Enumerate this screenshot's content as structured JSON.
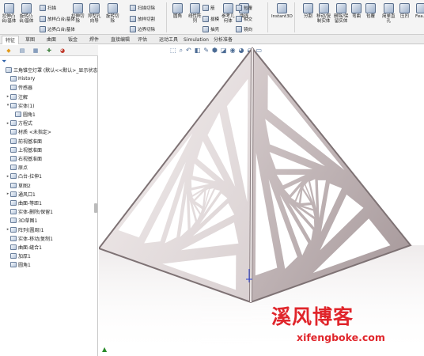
{
  "ribbon": {
    "buttons": [
      {
        "name": "extruded-boss-button",
        "icon": "extrude-icon",
        "label": "拉伸凸\n台/基体"
      },
      {
        "name": "revolved-boss-button",
        "icon": "revolve-icon",
        "label": "旋转凸\n台/基体"
      },
      {
        "name": "extruded-cut-button",
        "icon": "cut-extrude-icon",
        "label": "拉伸切\n除"
      },
      {
        "name": "hole-wizard-button",
        "icon": "hole-wizard-icon",
        "label": "异型孔\n向导"
      },
      {
        "name": "revolved-cut-button",
        "icon": "cut-revolve-icon",
        "label": "旋转切\n除"
      },
      {
        "name": "fillet-button",
        "icon": "fillet-icon",
        "label": "圆角"
      },
      {
        "name": "linear-pattern-button",
        "icon": "pattern-icon",
        "label": "线性阵\n列"
      },
      {
        "name": "reference-geometry-button",
        "icon": "reference-icon",
        "label": "参考几\n何体"
      },
      {
        "name": "curves-button",
        "icon": "curve-icon",
        "label": "曲线"
      },
      {
        "name": "instant3d-button",
        "icon": "instant3d-icon",
        "label": "Instant3D"
      },
      {
        "name": "split-button",
        "icon": "split-icon",
        "label": "分割"
      },
      {
        "name": "move-copy-body-button",
        "icon": "move-copy-icon",
        "label": "移动/复\n制实体"
      },
      {
        "name": "delete-keep-body-button",
        "icon": "delete-body-icon",
        "label": "删除/保\n留实体"
      },
      {
        "name": "wrap-button",
        "icon": "wrap-icon",
        "label": "弯曲"
      },
      {
        "name": "wrap2-button",
        "icon": "wrap2-icon",
        "label": "包覆"
      },
      {
        "name": "simple-hole-button",
        "icon": "simple-hole-icon",
        "label": "简单直\n孔"
      },
      {
        "name": "indent-button",
        "icon": "indent-icon",
        "label": "压凹"
      },
      {
        "name": "fea-button",
        "icon": "fea-icon",
        "label": "Fea..."
      }
    ],
    "small_buttons": [
      {
        "name": "sweep-button",
        "icon": "sweep-icon",
        "label": "扫描"
      },
      {
        "name": "loft-button",
        "icon": "loft-icon",
        "label": "放样凸台/基体"
      },
      {
        "name": "boundary-button",
        "icon": "boundary-icon",
        "label": "边界凸台/基体"
      },
      {
        "name": "swept-cut-button",
        "icon": "swept-cut-icon",
        "label": "扫描切除"
      },
      {
        "name": "lofted-cut-button",
        "icon": "lofted-cut-icon",
        "label": "放样切割"
      },
      {
        "name": "boundary-cut-button",
        "icon": "boundary-cut-icon",
        "label": "边界切除"
      },
      {
        "name": "rib-button",
        "icon": "rib-icon",
        "label": "筋"
      },
      {
        "name": "draft-button",
        "icon": "draft-icon",
        "label": "拔模"
      },
      {
        "name": "shell-button",
        "icon": "shell-icon",
        "label": "抽壳"
      },
      {
        "name": "wrap-small-button",
        "icon": "wrap-small-icon",
        "label": "包覆"
      },
      {
        "name": "intersect-button",
        "icon": "intersect-icon",
        "label": "相交"
      },
      {
        "name": "mirror-button",
        "icon": "mirror-icon",
        "label": "镜向"
      }
    ]
  },
  "tabs": [
    {
      "name": "tab-features",
      "label": "特征",
      "active": true
    },
    {
      "name": "tab-sketch",
      "label": "草图",
      "active": false
    },
    {
      "name": "tab-surfaces",
      "label": "曲面",
      "active": false
    },
    {
      "name": "tab-sheetmetal",
      "label": "钣金",
      "active": false
    },
    {
      "name": "tab-weldments",
      "label": "焊件",
      "active": false
    },
    {
      "name": "tab-direct-editing",
      "label": "直接编辑",
      "active": false
    },
    {
      "name": "tab-evaluate",
      "label": "评估",
      "active": false
    },
    {
      "name": "tab-motion",
      "label": "运动工具",
      "active": false
    },
    {
      "name": "tab-simulation",
      "label": "Simulation",
      "active": false
    },
    {
      "name": "tab-analysis",
      "label": "分析准备",
      "active": false
    }
  ],
  "panel_tabs": [
    {
      "name": "featuremanager-tab",
      "icon": "feature-tree-icon",
      "glyph": "◆"
    },
    {
      "name": "propertymanager-tab",
      "icon": "property-icon",
      "glyph": "▤"
    },
    {
      "name": "configuration-tab",
      "icon": "configuration-icon",
      "glyph": "▦"
    },
    {
      "name": "dimxpert-tab",
      "icon": "dimxpert-icon",
      "glyph": "✚"
    },
    {
      "name": "display-manager-tab",
      "icon": "display-icon",
      "glyph": "◕"
    }
  ],
  "tree": [
    {
      "label": "三角锥空灯罩 (默认<<默认>_显示状态",
      "indent": 0,
      "expand": "",
      "icon": "part-icon"
    },
    {
      "label": "History",
      "indent": 1,
      "expand": "",
      "icon": "history-icon"
    },
    {
      "label": "传感器",
      "indent": 1,
      "expand": "",
      "icon": "sensor-icon"
    },
    {
      "label": "注解",
      "indent": 1,
      "expand": "▸",
      "icon": "annotation-icon"
    },
    {
      "label": "实体(1)",
      "indent": 1,
      "expand": "▾",
      "icon": "solid-bodies-icon"
    },
    {
      "label": "圆角1",
      "indent": 2,
      "expand": "",
      "icon": "fillet-body-icon"
    },
    {
      "label": "方程式",
      "indent": 1,
      "expand": "▸",
      "icon": "equation-icon"
    },
    {
      "label": "材质 <未指定>",
      "indent": 1,
      "expand": "",
      "icon": "material-icon"
    },
    {
      "label": "前视基准面",
      "indent": 1,
      "expand": "",
      "icon": "plane-icon"
    },
    {
      "label": "上视基准面",
      "indent": 1,
      "expand": "",
      "icon": "plane-icon"
    },
    {
      "label": "右视基准面",
      "indent": 1,
      "expand": "",
      "icon": "plane-icon"
    },
    {
      "label": "原点",
      "indent": 1,
      "expand": "",
      "icon": "origin-icon"
    },
    {
      "label": "凸台-拉伸1",
      "indent": 1,
      "expand": "▸",
      "icon": "boss-extrude-icon"
    },
    {
      "label": "草图2",
      "indent": 1,
      "expand": "",
      "icon": "sketch-icon"
    },
    {
      "label": "通风口1",
      "indent": 1,
      "expand": "▸",
      "icon": "vent-icon"
    },
    {
      "label": "曲面-等距1",
      "indent": 1,
      "expand": "",
      "icon": "surface-offset-icon"
    },
    {
      "label": "实体-删除/保留1",
      "indent": 1,
      "expand": "",
      "icon": "delete-body-icon"
    },
    {
      "label": "3D草图1",
      "indent": 1,
      "expand": "",
      "icon": "sketch3d-icon"
    },
    {
      "label": "阵列(圆周)1",
      "indent": 1,
      "expand": "▸",
      "icon": "circular-pattern-icon"
    },
    {
      "label": "实体-移动/复制1",
      "indent": 1,
      "expand": "",
      "icon": "move-copy-icon"
    },
    {
      "label": "曲面-缝合1",
      "indent": 1,
      "expand": "",
      "icon": "knit-icon"
    },
    {
      "label": "加厚1",
      "indent": 1,
      "expand": "",
      "icon": "thicken-icon"
    },
    {
      "label": "圆角1",
      "indent": 1,
      "expand": "",
      "icon": "fillet-icon"
    }
  ],
  "headsup": [
    {
      "name": "zoom-to-fit-icon",
      "glyph": "⬚"
    },
    {
      "name": "zoom-area-icon",
      "glyph": "⌕"
    },
    {
      "name": "previous-view-icon",
      "glyph": "↶"
    },
    {
      "name": "section-view-icon",
      "glyph": "◧"
    },
    {
      "name": "dynamic-annotation-icon",
      "glyph": "✎"
    },
    {
      "name": "view-orientation-icon",
      "glyph": "⬢"
    },
    {
      "name": "display-style-icon",
      "glyph": "◪"
    },
    {
      "name": "hide-show-icon",
      "glyph": "◉"
    },
    {
      "name": "edit-appearance-icon",
      "glyph": "◕"
    },
    {
      "name": "apply-scene-icon",
      "glyph": "◒"
    },
    {
      "name": "view-settings-icon",
      "glyph": "▭"
    }
  ],
  "watermark": {
    "text": "溪风博客",
    "url": "xifengboke.com"
  },
  "colors": {
    "accent": "#e0252b",
    "model_light": "#f2ecec",
    "model_mid": "#d7cdce",
    "model_dark": "#9d8f91"
  }
}
